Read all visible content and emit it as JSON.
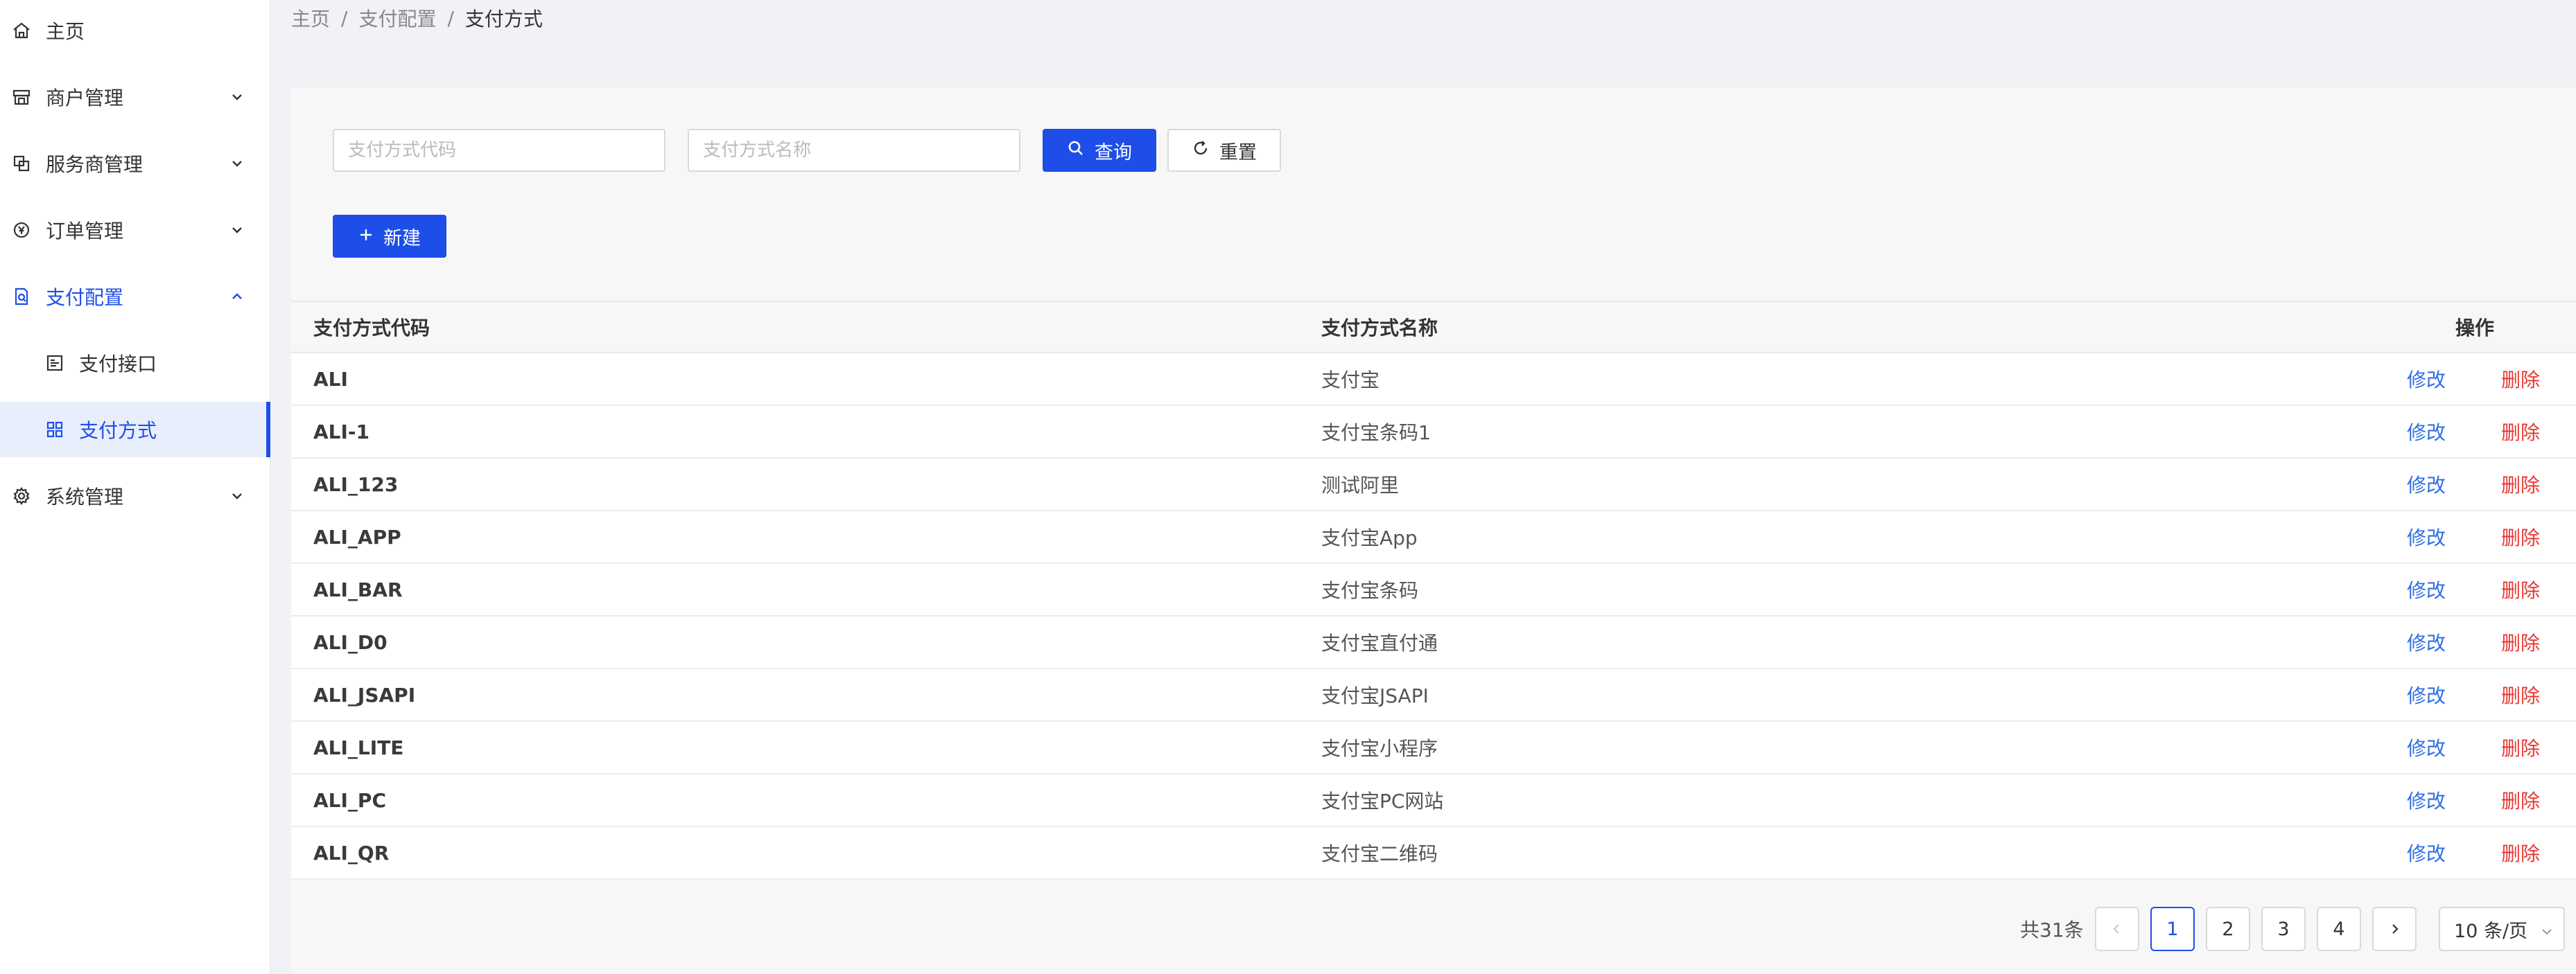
{
  "breadcrumb": {
    "home": "主页",
    "parent": "支付配置",
    "current": "支付方式",
    "separator": "/"
  },
  "sidebar": {
    "items": [
      {
        "label": "主页",
        "icon": "home-icon"
      },
      {
        "label": "商户管理",
        "icon": "store-icon"
      },
      {
        "label": "服务商管理",
        "icon": "copy-icon"
      },
      {
        "label": "订单管理",
        "icon": "yen-circle-icon"
      },
      {
        "label": "支付配置",
        "icon": "file-search-icon"
      },
      {
        "label": "支付接口",
        "icon": "profile-icon"
      },
      {
        "label": "支付方式",
        "icon": "appstore-icon"
      },
      {
        "label": "系统管理",
        "icon": "setting-icon"
      }
    ]
  },
  "filters": {
    "code_placeholder": "支付方式代码",
    "name_placeholder": "支付方式名称",
    "search_label": "查询",
    "reset_label": "重置"
  },
  "actions": {
    "new_label": "新建"
  },
  "table": {
    "columns": {
      "code": "支付方式代码",
      "name": "支付方式名称",
      "ops": "操作"
    },
    "edit_label": "修改",
    "delete_label": "删除",
    "rows": [
      {
        "code": "ALI",
        "name": "支付宝"
      },
      {
        "code": "ALI-1",
        "name": "支付宝条码1"
      },
      {
        "code": "ALI_123",
        "name": "测试阿里"
      },
      {
        "code": "ALI_APP",
        "name": "支付宝App"
      },
      {
        "code": "ALI_BAR",
        "name": "支付宝条码"
      },
      {
        "code": "ALI_D0",
        "name": "支付宝直付通"
      },
      {
        "code": "ALI_JSAPI",
        "name": "支付宝JSAPI"
      },
      {
        "code": "ALI_LITE",
        "name": "支付宝小程序"
      },
      {
        "code": "ALI_PC",
        "name": "支付宝PC网站"
      },
      {
        "code": "ALI_QR",
        "name": "支付宝二维码"
      }
    ]
  },
  "pagination": {
    "total_text": "共31条",
    "pages": [
      "1",
      "2",
      "3",
      "4"
    ],
    "current_page": "1",
    "page_size": "10 条/页"
  },
  "colors": {
    "primary": "#1e4ee8",
    "link": "#2f6fe0",
    "danger": "#e53935"
  }
}
